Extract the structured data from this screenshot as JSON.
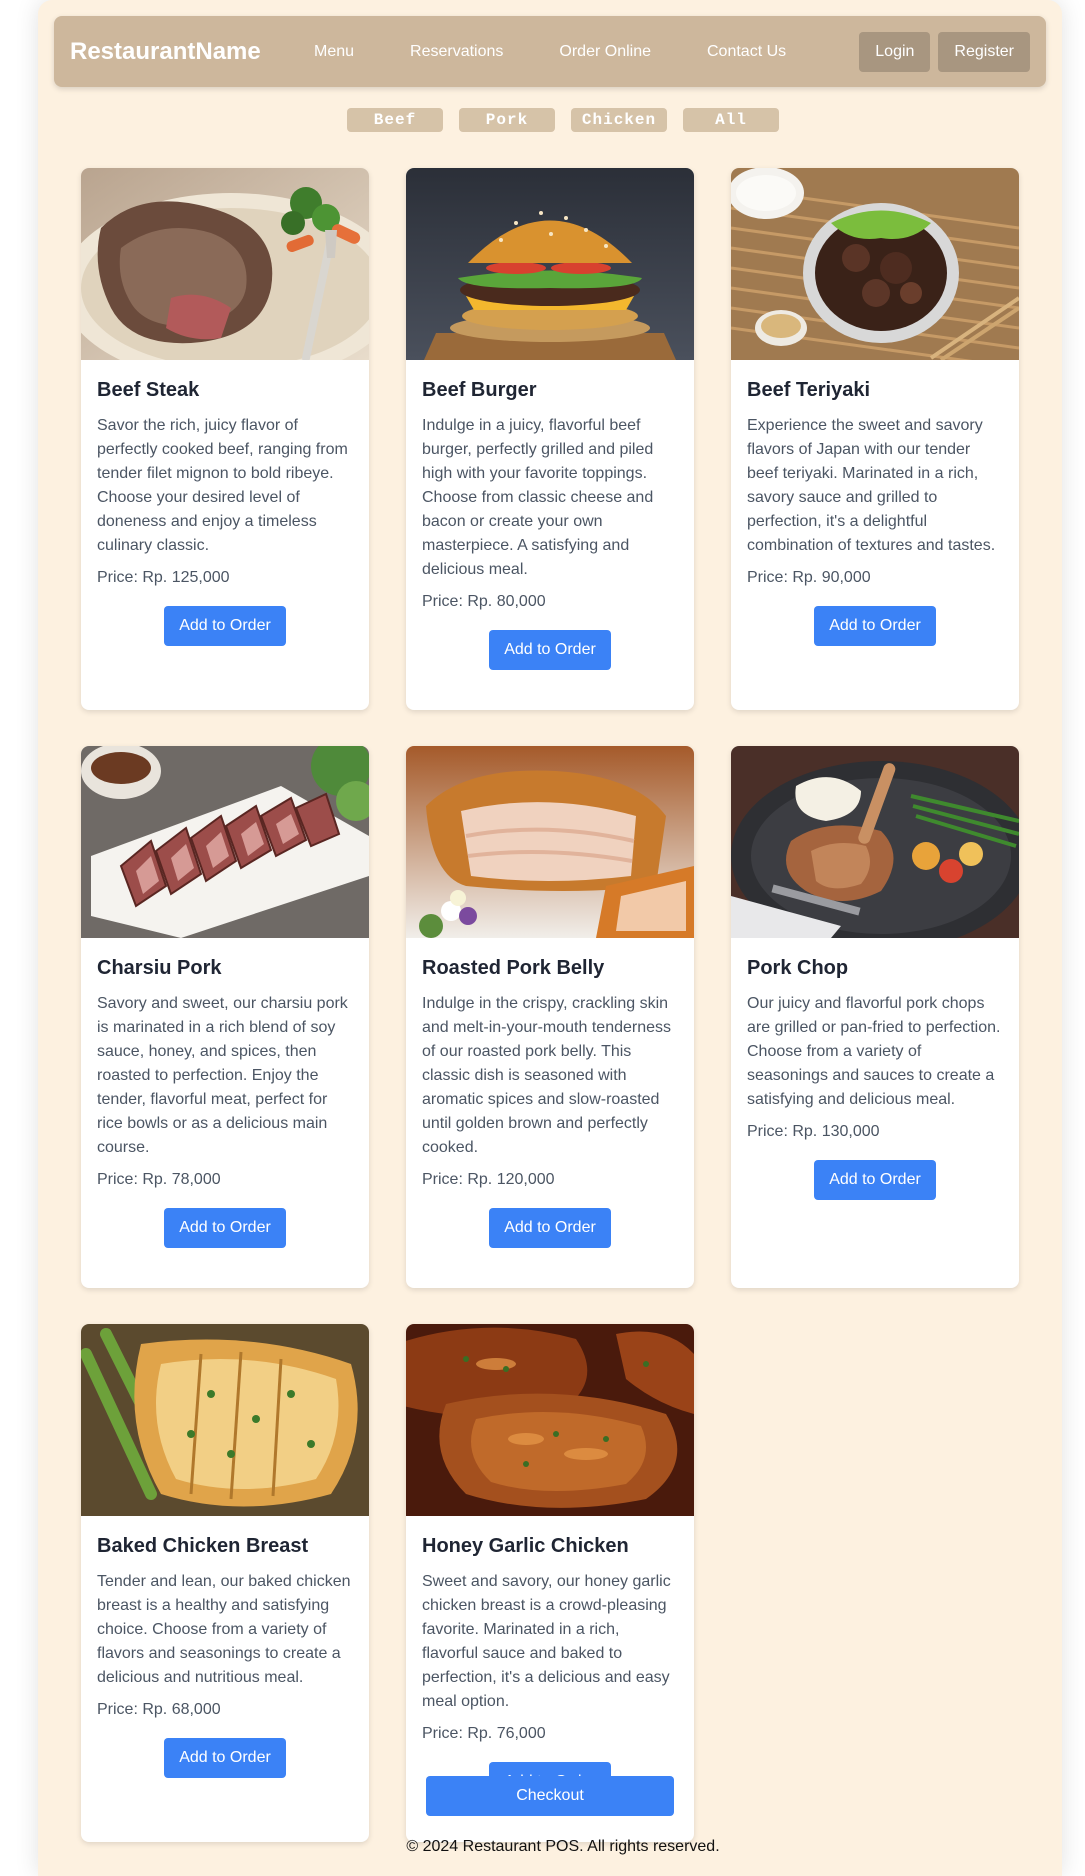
{
  "navbar": {
    "brand": "RestaurantName",
    "links": [
      "Menu",
      "Reservations",
      "Order Online",
      "Contact Us"
    ],
    "login_label": "Login",
    "register_label": "Register"
  },
  "filters": [
    "Beef",
    "Pork",
    "Chicken",
    "All"
  ],
  "order_label": "Add to Order",
  "menu": [
    {
      "name": "Beef Steak",
      "description": "Savor the rich, juicy flavor of perfectly cooked beef, ranging from tender filet mignon to bold ribeye. Choose your desired level of doneness and enjoy a timeless culinary classic.",
      "price": "Price: Rp. 125,000"
    },
    {
      "name": "Beef Burger",
      "description": "Indulge in a juicy, flavorful beef burger, perfectly grilled and piled high with your favorite toppings. Choose from classic cheese and bacon or create your own masterpiece. A satisfying and delicious meal.",
      "price": "Price: Rp. 80,000"
    },
    {
      "name": "Beef Teriyaki",
      "description": "Experience the sweet and savory flavors of Japan with our tender beef teriyaki. Marinated in a rich, savory sauce and grilled to perfection, it's a delightful combination of textures and tastes.",
      "price": "Price: Rp. 90,000"
    },
    {
      "name": "Charsiu Pork",
      "description": "Savory and sweet, our charsiu pork is marinated in a rich blend of soy sauce, honey, and spices, then roasted to perfection. Enjoy the tender, flavorful meat, perfect for rice bowls or as a delicious main course.",
      "price": "Price: Rp. 78,000"
    },
    {
      "name": "Roasted Pork Belly",
      "description": "Indulge in the crispy, crackling skin and melt-in-your-mouth tenderness of our roasted pork belly. This classic dish is seasoned with aromatic spices and slow-roasted until golden brown and perfectly cooked.",
      "price": "Price: Rp. 120,000"
    },
    {
      "name": "Pork Chop",
      "description": "Our juicy and flavorful pork chops are grilled or pan-fried to perfection. Choose from a variety of seasonings and sauces to create a satisfying and delicious meal.",
      "price": "Price: Rp. 130,000"
    },
    {
      "name": "Baked Chicken Breast",
      "description": "Tender and lean, our baked chicken breast is a healthy and satisfying choice. Choose from a variety of flavors and seasonings to create a delicious and nutritious meal.",
      "price": "Price: Rp. 68,000"
    },
    {
      "name": "Honey Garlic Chicken",
      "description": "Sweet and savory, our honey garlic chicken breast is a crowd-pleasing favorite. Marinated in a rich, flavorful sauce and baked to perfection, it's a delicious and easy meal option.",
      "price": "Price: Rp. 76,000"
    }
  ],
  "checkout_label": "Checkout",
  "footer": "© 2024 Restaurant POS. All rights reserved.",
  "colors": {
    "page_bg": "#fdf1e0",
    "navbar_bg": "#cdb79c",
    "auth_button_bg": "#a89680",
    "filter_bg": "#d6c3a8",
    "accent_blue": "#3b82f6"
  }
}
